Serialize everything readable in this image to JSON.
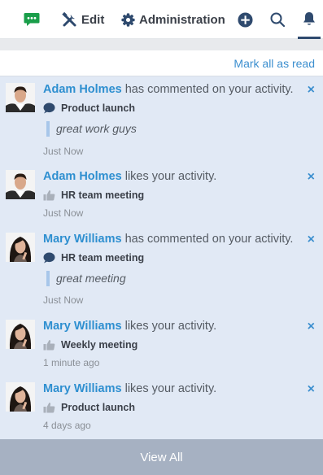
{
  "topbar": {
    "edit_label": "Edit",
    "admin_label": "Administration",
    "chat_color": "#1a9e4a",
    "plus_color": "#2f4a6e"
  },
  "panel": {
    "mark_all_label": "Mark all as read",
    "view_all_label": "View All"
  },
  "notifications": [
    {
      "name": "Adam Holmes",
      "action": " has commented on your activity.",
      "icon": "comment-icon",
      "subject": "Product launch",
      "quote": "great work guys",
      "time": "Just Now"
    },
    {
      "name": "Adam Holmes",
      "action": " likes your activity.",
      "icon": "thumbs-up-icon",
      "subject": "HR team meeting",
      "time": "Just Now"
    },
    {
      "name": "Mary Williams",
      "action": " has commented on your activity.",
      "icon": "comment-icon",
      "subject": "HR team meeting",
      "quote": "great meeting",
      "time": "Just Now"
    },
    {
      "name": "Mary Williams",
      "action": " likes your activity.",
      "icon": "thumbs-up-icon",
      "subject": "Weekly meeting",
      "time": "1 minute ago"
    },
    {
      "name": "Mary Williams",
      "action": " likes your activity.",
      "icon": "thumbs-up-icon",
      "subject": "Product launch",
      "time": "4 days ago"
    }
  ],
  "close_symbol": "×"
}
